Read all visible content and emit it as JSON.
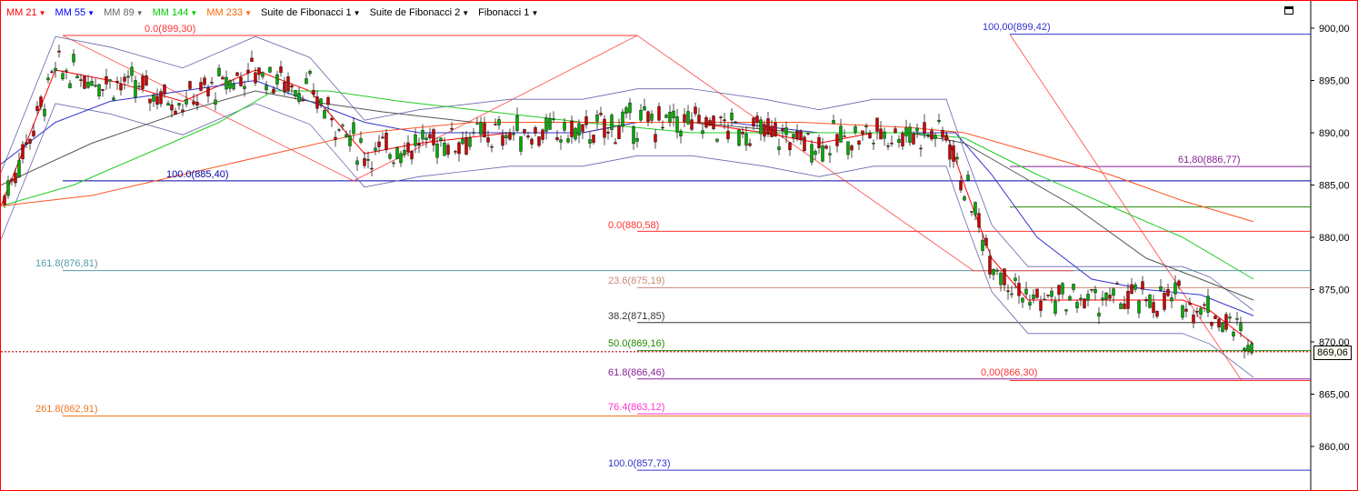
{
  "toolbar": {
    "items": [
      {
        "label": "MM 21",
        "color": "#ff0000"
      },
      {
        "label": "MM 55",
        "color": "#0000ff"
      },
      {
        "label": "MM 89",
        "color": "#666666"
      },
      {
        "label": "MM 144",
        "color": "#00cc00"
      },
      {
        "label": "MM 233",
        "color": "#ff6600"
      },
      {
        "label": "Suite de Fibonacci 1",
        "color": "#000000"
      },
      {
        "label": "Suite de Fibonacci 2",
        "color": "#000000"
      },
      {
        "label": "Fibonacci 1",
        "color": "#000000"
      }
    ],
    "maximize_icon": "maximize-window-icon"
  },
  "chart_data": {
    "type": "candlestick",
    "y_axis": {
      "min": 856,
      "max": 901.5,
      "ticks": [
        "900,00",
        "895,00",
        "890,00",
        "885,00",
        "880,00",
        "875,00",
        "870,00",
        "865,00",
        "860,00"
      ],
      "position": "right"
    },
    "current_price": {
      "value": 869.06,
      "label": "869,06",
      "color": "#c00000"
    },
    "moving_averages": [
      {
        "name": "MM 21",
        "color": "#ff0000",
        "points": [
          [
            0,
            883
          ],
          [
            60,
            896
          ],
          [
            120,
            895
          ],
          [
            200,
            893
          ],
          [
            280,
            896
          ],
          [
            340,
            894
          ],
          [
            400,
            888
          ],
          [
            460,
            889
          ],
          [
            560,
            890
          ],
          [
            640,
            890
          ],
          [
            700,
            891
          ],
          [
            760,
            891
          ],
          [
            840,
            890
          ],
          [
            900,
            889
          ],
          [
            960,
            890
          ],
          [
            1040,
            890
          ],
          [
            1060,
            885
          ],
          [
            1090,
            878
          ],
          [
            1130,
            874
          ],
          [
            1180,
            874
          ],
          [
            1230,
            874
          ],
          [
            1300,
            874
          ],
          [
            1330,
            873
          ],
          [
            1360,
            871
          ],
          [
            1378,
            869.8
          ]
        ]
      },
      {
        "name": "MM 55",
        "color": "#3333cc",
        "points": [
          [
            0,
            887
          ],
          [
            60,
            891
          ],
          [
            120,
            893
          ],
          [
            200,
            894
          ],
          [
            280,
            895
          ],
          [
            340,
            893
          ],
          [
            400,
            891
          ],
          [
            460,
            890
          ],
          [
            560,
            890
          ],
          [
            640,
            890
          ],
          [
            700,
            891
          ],
          [
            800,
            891
          ],
          [
            900,
            890
          ],
          [
            1000,
            890
          ],
          [
            1050,
            890
          ],
          [
            1090,
            886
          ],
          [
            1140,
            880
          ],
          [
            1200,
            876
          ],
          [
            1260,
            875
          ],
          [
            1320,
            874.5
          ],
          [
            1378,
            872.5
          ]
        ]
      },
      {
        "name": "MM 89",
        "color": "#555555",
        "points": [
          [
            0,
            885
          ],
          [
            100,
            889
          ],
          [
            200,
            892
          ],
          [
            280,
            894
          ],
          [
            340,
            893
          ],
          [
            420,
            892
          ],
          [
            520,
            891
          ],
          [
            640,
            891
          ],
          [
            760,
            891
          ],
          [
            880,
            890
          ],
          [
            1000,
            890
          ],
          [
            1060,
            889
          ],
          [
            1120,
            886
          ],
          [
            1180,
            883
          ],
          [
            1260,
            878
          ],
          [
            1320,
            876
          ],
          [
            1378,
            874
          ]
        ]
      },
      {
        "name": "MM 144",
        "color": "#22cc22",
        "points": [
          [
            0,
            883
          ],
          [
            80,
            885
          ],
          [
            160,
            888
          ],
          [
            240,
            891
          ],
          [
            300,
            894
          ],
          [
            360,
            894
          ],
          [
            440,
            893
          ],
          [
            540,
            892
          ],
          [
            640,
            891
          ],
          [
            760,
            890
          ],
          [
            880,
            890
          ],
          [
            1000,
            890
          ],
          [
            1060,
            889.5
          ],
          [
            1140,
            886
          ],
          [
            1220,
            883
          ],
          [
            1300,
            880
          ],
          [
            1378,
            876
          ]
        ]
      },
      {
        "name": "MM 233",
        "color": "#ff5522",
        "points": [
          [
            0,
            883
          ],
          [
            100,
            884
          ],
          [
            200,
            886
          ],
          [
            300,
            888
          ],
          [
            400,
            890
          ],
          [
            520,
            891
          ],
          [
            640,
            891
          ],
          [
            760,
            891
          ],
          [
            880,
            891
          ],
          [
            1000,
            890.5
          ],
          [
            1060,
            890
          ],
          [
            1140,
            888
          ],
          [
            1220,
            886
          ],
          [
            1300,
            883.5
          ],
          [
            1378,
            881.5
          ]
        ]
      }
    ],
    "fibonacci_levels": [
      {
        "label": "0.0(899,30)",
        "value": 899.3,
        "color": "#ff3333"
      },
      {
        "label": "100.0(885,40)",
        "value": 885.4,
        "color": "#0000aa"
      },
      {
        "label": "161.8(876,81)",
        "value": 876.81,
        "color": "#5599aa"
      },
      {
        "label": "261.8(862,91)",
        "value": 862.91,
        "color": "#ee7722"
      },
      {
        "label": "0.0(880,58)",
        "value": 880.58,
        "color": "#ff3333"
      },
      {
        "label": "23.6(875,19)",
        "value": 875.19,
        "color": "#cc8877"
      },
      {
        "label": "38.2(871,85)",
        "value": 871.85,
        "color": "#333333"
      },
      {
        "label": "50.0(869,16)",
        "value": 869.16,
        "color": "#228800"
      },
      {
        "label": "61.8(866,46)",
        "value": 866.46,
        "color": "#882299"
      },
      {
        "label": "76.4(863,12)",
        "value": 863.12,
        "color": "#ff33cc"
      },
      {
        "label": "100.0(857,73)",
        "value": 857.73,
        "color": "#3333cc"
      },
      {
        "label": "100,00(899,42)",
        "value": 899.42,
        "color": "#3333cc"
      },
      {
        "label": "61,80(886,77)",
        "value": 886.77,
        "color": "#882299"
      },
      {
        "label": "0,00(866,30)",
        "value": 866.3,
        "color": "#ff3333"
      }
    ],
    "fib_extra_level": {
      "value": 882.9,
      "color": "#228800"
    }
  }
}
